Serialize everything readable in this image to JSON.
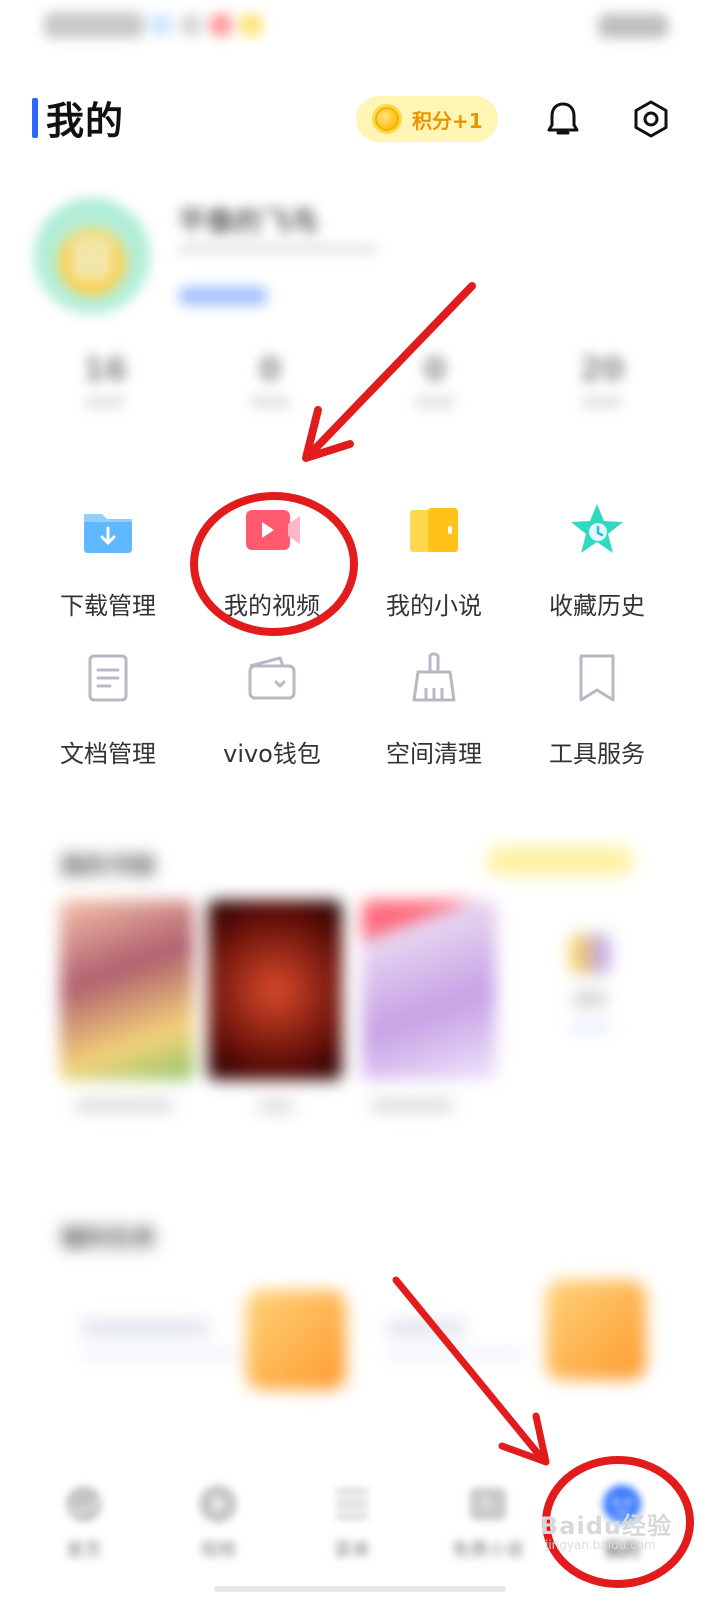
{
  "header": {
    "title": "我的",
    "points_badge": "积分+1"
  },
  "profile": {
    "username": "平像的飞鸟",
    "stats": [
      "16",
      "0",
      "0",
      "20"
    ]
  },
  "grid": [
    {
      "label": "下载管理",
      "icon": "download-folder-icon"
    },
    {
      "label": "我的视频",
      "icon": "video-icon"
    },
    {
      "label": "我的小说",
      "icon": "novel-icon"
    },
    {
      "label": "收藏历史",
      "icon": "star-history-icon"
    },
    {
      "label": "文档管理",
      "icon": "document-icon"
    },
    {
      "label": "vivo钱包",
      "icon": "wallet-icon"
    },
    {
      "label": "空间清理",
      "icon": "brush-icon"
    },
    {
      "label": "工具服务",
      "icon": "bookmark-icon"
    }
  ],
  "nav": [
    {
      "label": "首页",
      "icon": "home-icon"
    },
    {
      "label": "视频",
      "icon": "play-icon"
    },
    {
      "label": "菜单",
      "icon": "menu-icon"
    },
    {
      "label": "免费小说",
      "icon": "book-icon"
    },
    {
      "label": "我的",
      "icon": "profile-icon"
    }
  ],
  "watermark": {
    "text": "Baidu经验",
    "sub": "jingyan.baidu.com"
  },
  "colors": {
    "accent": "#2f66ff",
    "annotation": "#e21c1c",
    "points": "#fff6b5"
  }
}
